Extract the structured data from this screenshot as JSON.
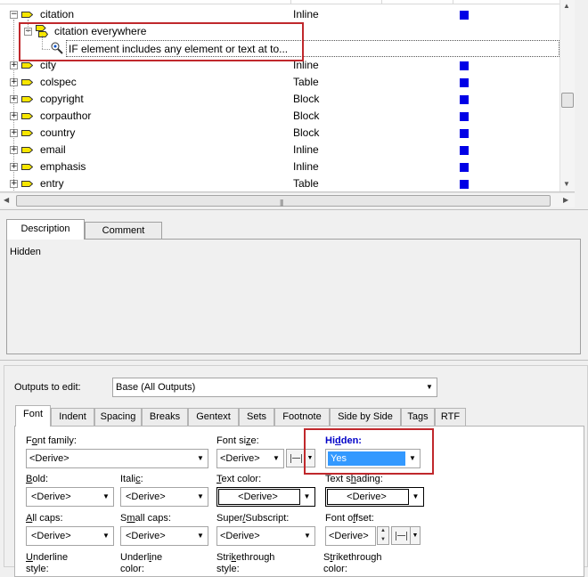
{
  "tree": {
    "rows": [
      {
        "toggle": "−",
        "name": "citation",
        "type": "Inline",
        "square": true
      },
      {
        "toggle": "−",
        "name": "citation everywhere",
        "type": "",
        "square": false
      },
      {
        "toggle": "",
        "name": "IF element includes any element or text at to...",
        "type": "",
        "square": false
      },
      {
        "toggle": "+",
        "name": "city",
        "type": "Inline",
        "square": true
      },
      {
        "toggle": "+",
        "name": "colspec",
        "type": "Table",
        "square": true
      },
      {
        "toggle": "+",
        "name": "copyright",
        "type": "Block",
        "square": true
      },
      {
        "toggle": "+",
        "name": "corpauthor",
        "type": "Block",
        "square": true
      },
      {
        "toggle": "+",
        "name": "country",
        "type": "Block",
        "square": true
      },
      {
        "toggle": "+",
        "name": "email",
        "type": "Inline",
        "square": true
      },
      {
        "toggle": "+",
        "name": "emphasis",
        "type": "Inline",
        "square": true
      },
      {
        "toggle": "+",
        "name": "entry",
        "type": "Table",
        "square": true
      }
    ],
    "scroll_up": "▲",
    "scroll_down": "▼",
    "scroll_left": "◀",
    "scroll_right": "▶",
    "grip": "|||"
  },
  "desc_tabs": {
    "description": "Description",
    "comment": "Comment"
  },
  "description_text": "Hidden",
  "outputs": {
    "label": "Outputs to edit:",
    "value": "Base (All Outputs)"
  },
  "prop_tabs": [
    "Font",
    "Indent",
    "Spacing",
    "Breaks",
    "Gentext",
    "Sets",
    "Footnote",
    "Side by Side",
    "Tags",
    "RTF"
  ],
  "font_tab": {
    "font_family": {
      "label_pre": "F",
      "label_u": "o",
      "label_post": "nt family:",
      "value": "<Derive>"
    },
    "font_size": {
      "label_pre": "Font si",
      "label_u": "z",
      "label_post": "e:",
      "value": "<Derive>"
    },
    "hidden": {
      "label_pre": "Hi",
      "label_u": "d",
      "label_post": "den:",
      "value": "Yes"
    },
    "bold": {
      "label_pre": "",
      "label_u": "B",
      "label_post": "old:",
      "value": "<Derive>"
    },
    "italic": {
      "label_pre": "Itali",
      "label_u": "c",
      "label_post": ":",
      "value": "<Derive>"
    },
    "text_color": {
      "label_pre": "",
      "label_u": "T",
      "label_post": "ext color:",
      "value": "<Derive>"
    },
    "text_shading": {
      "label_pre": "Text s",
      "label_u": "h",
      "label_post": "ading:",
      "value": "<Derive>"
    },
    "all_caps": {
      "label_pre": "",
      "label_u": "A",
      "label_post": "ll caps:",
      "value": "<Derive>"
    },
    "small_caps": {
      "label_pre": "S",
      "label_u": "m",
      "label_post": "all caps:",
      "value": "<Derive>"
    },
    "super_sub": {
      "label_pre": "Super",
      "label_u": "/",
      "label_post": "Subscript:",
      "value": "<Derive>"
    },
    "font_offset": {
      "label_pre": "Font o",
      "label_u": "f",
      "label_post": "fset:",
      "value": "<Derive>"
    },
    "underline_style": {
      "label_pre": "",
      "label_u": "U",
      "label_post": "nderline",
      "label2": "style:"
    },
    "underline_color": {
      "label_pre": "Underl",
      "label_u": "i",
      "label_post": "ne",
      "label2": "color:"
    },
    "strike_style": {
      "label_pre": "Stri",
      "label_u": "k",
      "label_post": "ethrough",
      "label2": "style:"
    },
    "strike_color": {
      "label_pre": "S",
      "label_u": "t",
      "label_post": "rikethrough",
      "label2": "color:"
    }
  },
  "dropdown_glyph": "▼",
  "spin_up": "▲",
  "spin_down": "▼",
  "colors": {
    "hidden_label": "#0000c8",
    "selected_blue": "#3399ff",
    "highlight_red": "#c0282c",
    "square_blue": "#0000e6"
  }
}
